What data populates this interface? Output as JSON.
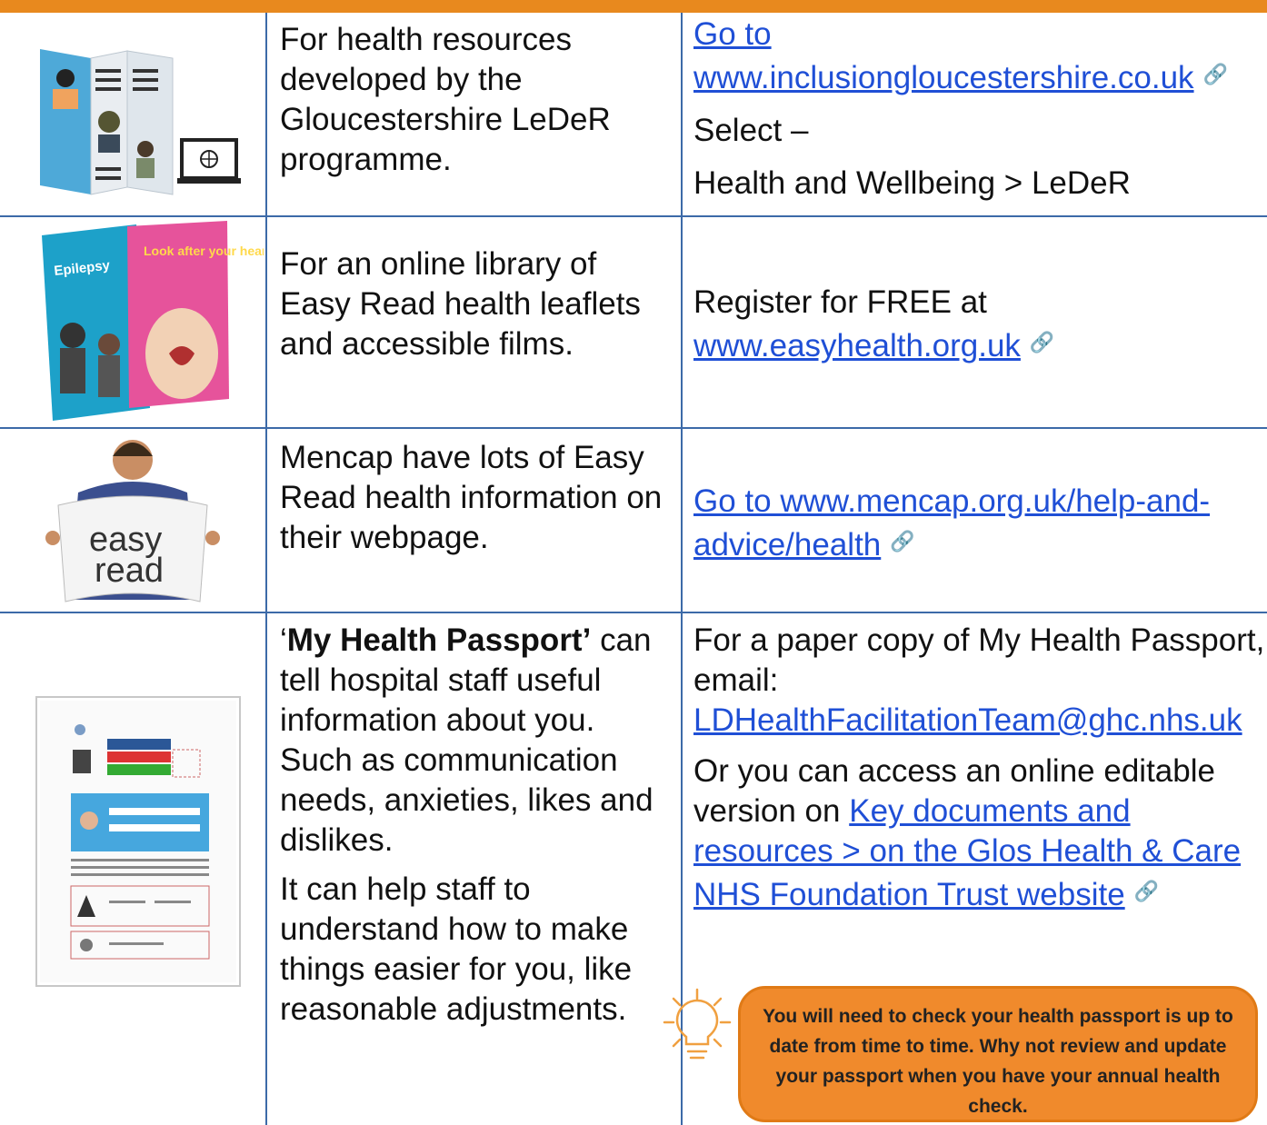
{
  "rows": [
    {
      "image_icon": "leaflet-and-laptop-illustration",
      "description": "For health resources developed by the Gloucestershire LeDeR programme.",
      "link_text": "Go to www.inclusiongloucestershire.co.uk",
      "select_label": "Select –",
      "path": "Health and Wellbeing > LeDeR"
    },
    {
      "image_icon": "easy-read-leaflets-illustration",
      "leaflet_word_1": "Epilepsy",
      "leaflet_word_2": "Look after your heart",
      "description": "For an online library of Easy Read health leaflets and accessible films.",
      "register_text": "Register for FREE at",
      "link_text": "www.easyhealth.org.uk"
    },
    {
      "image_icon": "man-reading-easy-read-paper-illustration",
      "paper_text_1": "easy",
      "paper_text_2": "read",
      "description": "Mencap have lots of Easy Read health information on their webpage.",
      "link_text": "Go to www.mencap.org.uk/help-and-advice/health"
    },
    {
      "image_icon": "health-passport-document-thumbnail",
      "quote_open": "‘",
      "bold_title": "My Health Passport’",
      "description": "can tell hospital staff useful information about you.  Such as communication needs, anxieties, likes and dislikes.",
      "description_2": "It can help staff to understand how to make things easier for you, like reasonable adjustments.",
      "paper_copy_text": "For a paper copy of My Health Passport, email:",
      "email": "LDHealthFacilitationTeam@ghc.nhs.uk",
      "online_text": "Or you can access an online editable version on",
      "link_text": "Key documents and resources > on the Glos Health & Care NHS Foundation Trust website"
    }
  ],
  "link_icon": "🔗",
  "tip": {
    "icon": "lightbulb-icon",
    "text": "You will need to check your health passport is up to date from time to time.  Why not review and update your passport when you have your annual health check."
  },
  "colors": {
    "header_bar": "#e8891e",
    "grid_lines": "#3c6aa8",
    "link": "#1f4fd6",
    "tip_fill": "#f08a2c"
  }
}
